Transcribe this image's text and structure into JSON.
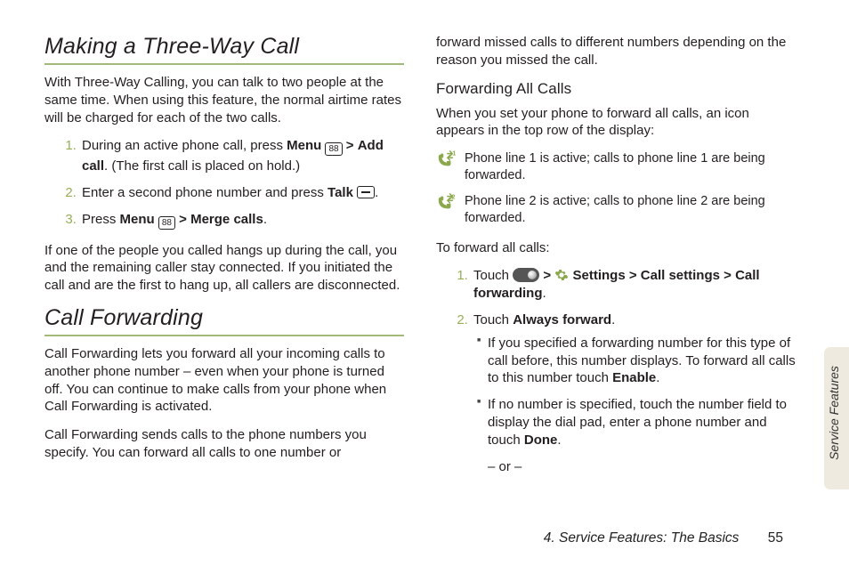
{
  "left": {
    "h1": "Making a Three-Way Call",
    "p1": "With Three-Way Calling, you can talk to two people at the same time. When using this feature, the normal airtime rates will be charged for each of the two calls.",
    "s1a": "During an active phone call, press ",
    "s1_menu": "Menu",
    "s1_gt": ">",
    "s1_add": "Add call",
    "s1b": ". (The first call is placed on hold.)",
    "s2a": "Enter a second phone number and press ",
    "s2_talk": "Talk",
    "s2b": ".",
    "s3a": "Press ",
    "s3_menu": "Menu",
    "s3_gt": ">",
    "s3_merge": "Merge calls",
    "s3b": ".",
    "p2": "If one of the people you called hangs up during the call, you and the remaining caller stay connected. If you initiated the call and are the first to hang up, all callers are disconnected.",
    "h2": "Call Forwarding",
    "p3": "Call Forwarding lets you forward all your incoming calls to another phone number – even when your phone is turned off. You can continue to make calls from your phone when Call Forwarding is activated.",
    "p4": "Call Forwarding sends calls to the phone numbers you specify. You can forward all calls to one number or"
  },
  "right": {
    "p0": "forward missed calls to different numbers depending on the reason you missed the call.",
    "sub1": "Forwarding All Calls",
    "p1": "When you set your phone to forward all calls, an icon appears in the top row of the display:",
    "icon1": "Phone line 1 is active; calls to phone line 1 are being forwarded.",
    "icon2": "Phone line 2 is active; calls to phone line 2 are being forwarded.",
    "p2": "To forward all calls:",
    "s1a": "Touch ",
    "s1_gt": ">",
    "s1_settings": "Settings",
    "s1_callset": "Call settings",
    "s1_callfwd": "Call forwarding",
    "s1b": ".",
    "s2a": "Touch ",
    "s2_always": "Always forward",
    "s2b": ".",
    "bullet1a": "If you specified a forwarding number for this type of call before, this number displays. To forward all calls to this number touch ",
    "bullet1_enable": "Enable",
    "bullet1b": ".",
    "bullet2a": "If no number is specified, touch the number field to display the dial pad, enter a phone number and touch ",
    "bullet2_done": "Done",
    "bullet2b": ".",
    "or": "– or –"
  },
  "sidetab": "Service Features",
  "footer_chapter": "4. Service Features: The Basics",
  "footer_page": "55"
}
